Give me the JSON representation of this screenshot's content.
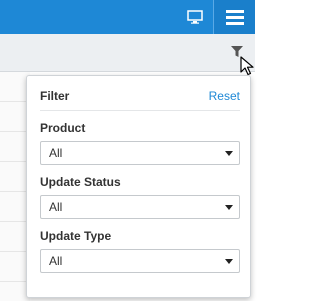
{
  "filter_panel": {
    "title": "Filter",
    "reset_label": "Reset",
    "fields": [
      {
        "label": "Product",
        "value": "All"
      },
      {
        "label": "Update Status",
        "value": "All"
      },
      {
        "label": "Update Type",
        "value": "All"
      }
    ]
  },
  "colors": {
    "topbar": "#1e88d6",
    "link": "#1e88d6"
  },
  "icons": {
    "top_left": "monitor-icon",
    "top_right": "hamburger-menu-icon",
    "filterbar": "filter-funnel-icon"
  }
}
